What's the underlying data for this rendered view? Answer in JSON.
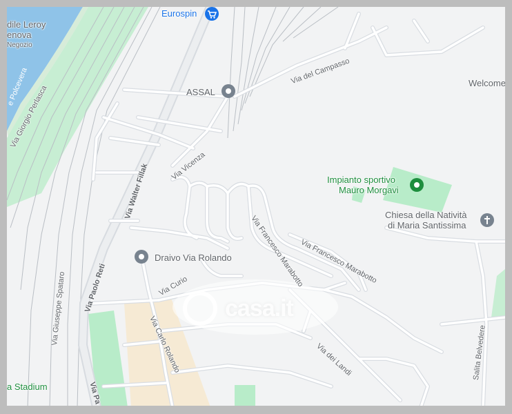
{
  "map": {
    "colors": {
      "background": "#f2f3f4",
      "water": "#8fc3e8",
      "park": "#b8ecc9",
      "rail_area": "#c7eed3",
      "sand": "#f6ead4",
      "road": "#ffffff",
      "road_casing": "#d7dbe0",
      "major_road": "#e6e8eb",
      "rail": "#b0b6bd",
      "frame": "#bdbdbd"
    },
    "places": {
      "eurospin": "Eurospin",
      "assal": "ASSAL",
      "draivo": "Draivo Via Rolando",
      "impianto_line1": "Impianto sportivo",
      "impianto_line2": "Mauro Morgavi",
      "chiesa_line1": "Chiesa della Natività",
      "chiesa_line2": "di Maria Santissima",
      "welcome": "Welcome",
      "stadium": "a Stadium",
      "leroy_line1": "dile Leroy",
      "leroy_line2": "enova",
      "leroy_line3": "Negozio"
    },
    "roads": {
      "via_del_campasso": "Via del Campasso",
      "via_giorgio_perlasca": "Via Giorgio Perlasca",
      "polcevera": "e Polcevera",
      "via_walter_fillak": "Via Walter Fillak",
      "via_vicenza": "Via Vicenza",
      "via_francesco_marabotto_1": "Via Francesco Marabotto",
      "via_francesco_marabotto_2": "Via Francesco Marabotto",
      "via_paolo_reti": "Via Paolo Reti",
      "via_curio": "Via Curio",
      "via_giuseppe_spataro": "Via Giuseppe Spataro",
      "via_carlo_rolando": "Via Carlo Rolando",
      "via_dei_landi": "Via dei Landi",
      "salita_belvedere": "Salita Belvedere",
      "via_pa": "Via Pa"
    },
    "watermark": "casa.it",
    "icons": {
      "eurospin": "shopping-cart-icon",
      "assal": "place-pin-icon",
      "draivo": "place-pin-icon",
      "impianto": "sports-pin-icon",
      "chiesa": "cross-icon"
    }
  }
}
